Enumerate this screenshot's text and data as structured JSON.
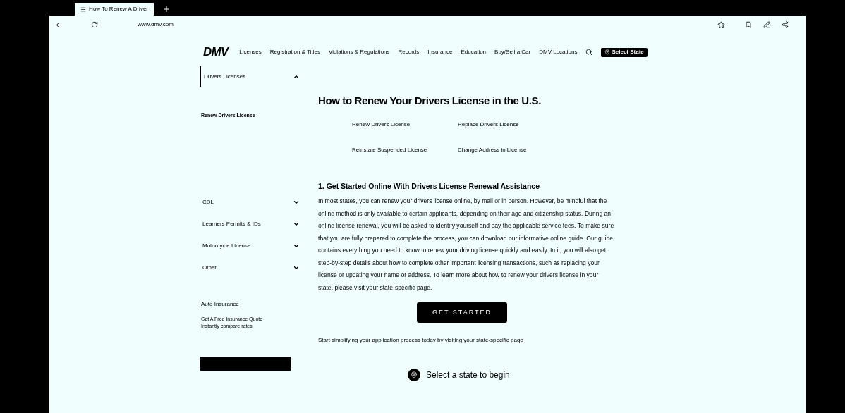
{
  "browser": {
    "tab_title": "How To Renew A Driver",
    "url": "www.dmv.com"
  },
  "nav": {
    "logo": "DMV",
    "items": [
      "Licenses",
      "Registration & Titles",
      "Violations & Regulations",
      "Records",
      "Insurance",
      "Education",
      "Buy/Sell a Car",
      "DMV Locations"
    ],
    "select_state": "Select State"
  },
  "sidebar": {
    "sections": [
      {
        "label": "Drivers Licenses",
        "expanded": true,
        "children": [
          {
            "label": "Renew Drivers License",
            "selected": true
          }
        ]
      },
      {
        "label": "CDL",
        "expanded": false
      },
      {
        "label": "Learners Permits & IDs",
        "expanded": false
      },
      {
        "label": "Motorcycle License",
        "expanded": false
      },
      {
        "label": "Other",
        "expanded": false
      }
    ],
    "promo": {
      "title": "Auto Insurance",
      "lines": [
        "Get A Free Insurance Quote",
        "Instantly compare rates"
      ]
    }
  },
  "main": {
    "title": "How to Renew Your Drivers License in the U.S.",
    "links": [
      "Renew Drivers License",
      "Replace Drivers License",
      "Reinstate Suspended License",
      "Change Address in License"
    ],
    "section_title": "1. Get Started Online With Drivers License Renewal Assistance",
    "paragraph": "In most states, you can renew your drivers license online, by mail or in person. However, be mindful that the online method is only available to certain applicants, depending on their age and citizenship status. During an online license renewal, you will be asked to identify yourself and pay the applicable service fees. To make sure that you are fully prepared to complete the process, you can download our informative online guide. Our guide contains everything you need to know to renew your driving license quickly and easily. In it, you will also get step-by-step details about how to complete other important licensing transactions, such as replacing your license or updating your name or address. To learn more about how to renew your drivers license in your state, please visit your state-specific page.",
    "button": "GET STARTED",
    "note": "Start simplifying your application process today by visiting your state-specific page",
    "select_prompt": "Select a state to begin"
  }
}
